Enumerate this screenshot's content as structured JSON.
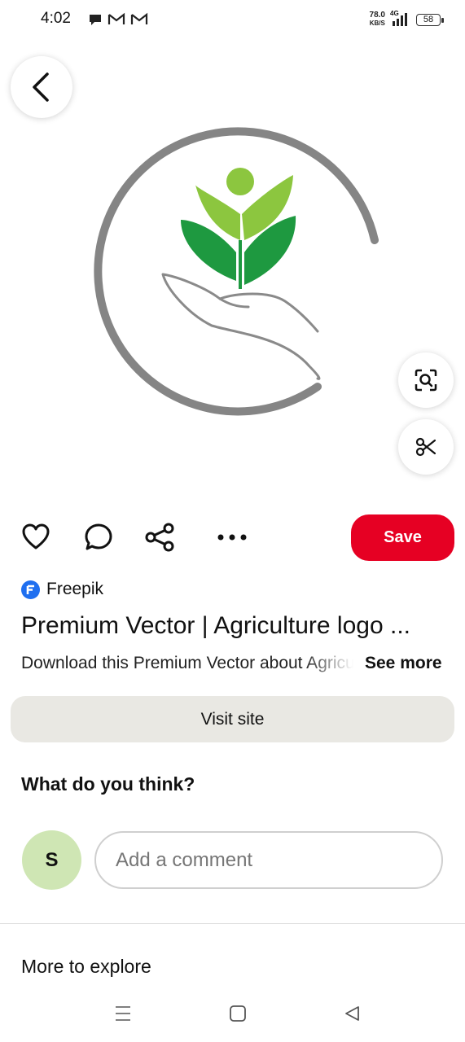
{
  "status_bar": {
    "time": "4:02",
    "net_speed_value": "78.0",
    "net_speed_unit": "KB/S",
    "network": "4G",
    "battery": "58"
  },
  "pin": {
    "source_name": "Freepik",
    "title": "Premium Vector | Agriculture logo ...",
    "description": "Download this Premium Vector about Agriculture logo",
    "see_more_label": "See more",
    "save_label": "Save",
    "visit_site_label": "Visit site"
  },
  "comments": {
    "heading": "What do you think?",
    "avatar_initial": "S",
    "placeholder": "Add a comment"
  },
  "more_to_explore": "More to explore",
  "colors": {
    "save_red": "#e60023",
    "leaf_light": "#8cc63f",
    "leaf_dark": "#1e9940",
    "ring_gray": "#808080",
    "avatar_bg": "#cfe6b4",
    "visit_bg": "#e9e8e3"
  }
}
